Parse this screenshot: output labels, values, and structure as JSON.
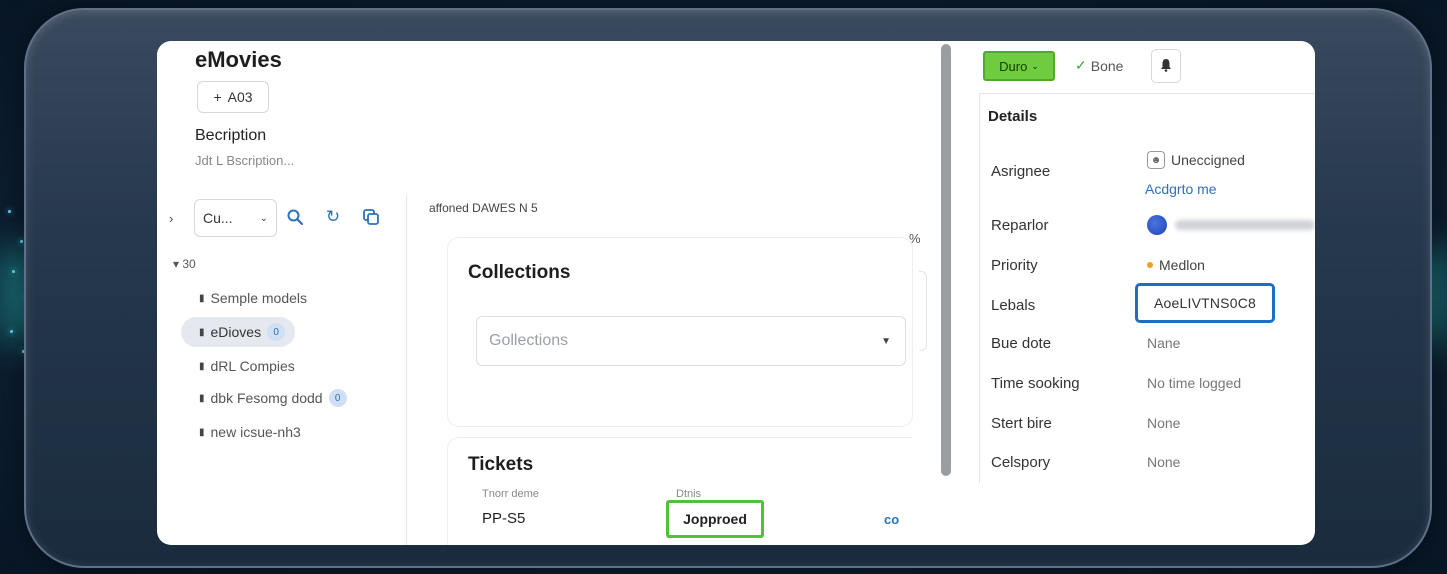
{
  "header": {
    "app_title": "eMovies",
    "add_label": "A03",
    "description_label": "Becription",
    "description_placeholder": "Jdt L Bscription..."
  },
  "tree": {
    "filter_value": "Cu...",
    "root_label": "30",
    "items": [
      {
        "label": "Semple models",
        "active": false,
        "badge": ""
      },
      {
        "label": "eDioves",
        "active": true,
        "badge": "0"
      },
      {
        "label": "dRL Compies",
        "active": false,
        "badge": ""
      },
      {
        "label": "dbk Fesomg dodd",
        "active": false,
        "badge": "0"
      },
      {
        "label": "new icsue-nh3",
        "active": false,
        "badge": ""
      }
    ]
  },
  "main": {
    "caption": "affoned DAWES N 5",
    "corner_mark": "%",
    "collections": {
      "title": "Collections",
      "select_placeholder": "Gollections"
    },
    "tickets": {
      "title": "Tickets",
      "col_id": "Tnorr deme",
      "col_status": "Dtnis",
      "row": {
        "id": "PP-S5",
        "status": "Jopproed",
        "link": "co"
      }
    }
  },
  "issue": {
    "status_label": "Duro",
    "done_label": "Bone",
    "details_title": "Details",
    "fields": {
      "assignee_label": "Asrignee",
      "assignee_value": "Uneccigned",
      "assign_link": "Acdgrto me",
      "reporter_label": "Reparlor",
      "priority_label": "Priority",
      "priority_value": "Medlon",
      "labels_label": "Lebals",
      "labels_value": "AoeLIVTNS0C8",
      "due_label": "Bue dote",
      "due_value": "Nane",
      "time_label": "Time sooking",
      "time_value": "No time logged",
      "start_label": "Stert bire",
      "start_value": "None",
      "category_label": "Celspory",
      "category_value": "None"
    }
  },
  "colors": {
    "status_green": "#6fcc3e",
    "accent_blue": "#1e6fc0",
    "approved_border": "#4fc23a"
  },
  "icons": {
    "add": "plus-icon",
    "search": "search-icon",
    "refresh": "refresh-icon",
    "copy": "copy-icon",
    "watch": "bell-icon",
    "link": "link-icon",
    "user": "user-icon"
  }
}
